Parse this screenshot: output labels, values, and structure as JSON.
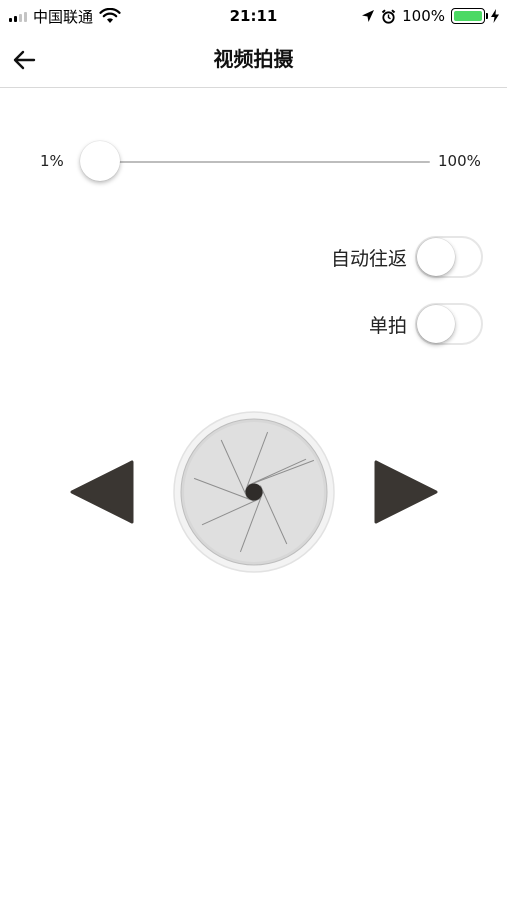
{
  "status_bar": {
    "carrier": "中国联通",
    "time": "21:11",
    "battery_pct": "100%",
    "icons": [
      "signal-icon",
      "wifi-icon",
      "location-arrow-icon",
      "alarm-icon",
      "battery-icon",
      "charging-bolt-icon"
    ],
    "battery_color": "#4cd964"
  },
  "nav": {
    "title": "视频拍摄",
    "back_icon": "arrow-left-icon"
  },
  "slider": {
    "min_label": "1%",
    "max_label": "100%",
    "value": 1,
    "min": 1,
    "max": 100
  },
  "toggles": [
    {
      "label": "自动往返",
      "on": false
    },
    {
      "label": "单拍",
      "on": false
    }
  ],
  "controls": {
    "prev_icon": "triangle-left-icon",
    "shutter_icon": "aperture-shutter-icon",
    "next_icon": "triangle-right-icon",
    "control_color": "#3a3632"
  }
}
